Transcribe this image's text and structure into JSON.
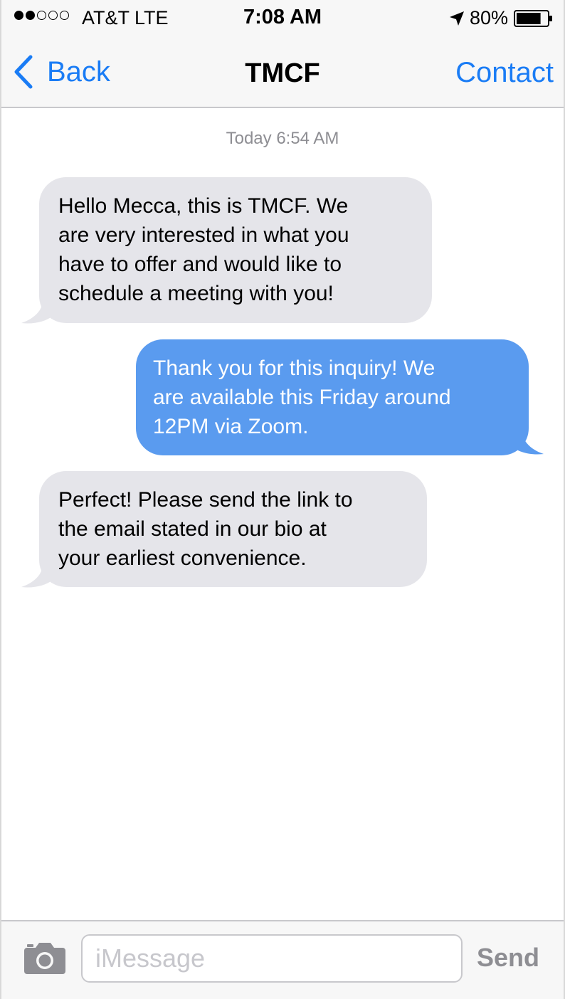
{
  "status_bar": {
    "signal_filled": 2,
    "signal_empty": 3,
    "carrier": "AT&T LTE",
    "time": "7:08 AM",
    "battery_percent": "80%",
    "battery_level": 0.8,
    "icons": [
      "signal-dots-icon",
      "location-arrow-icon",
      "battery-icon"
    ]
  },
  "nav": {
    "back_label": "Back",
    "title": "TMCF",
    "contact_label": "Contact",
    "accent_color": "#1a7cf5"
  },
  "conversation": {
    "timestamp": "Today 6:54 AM",
    "messages": [
      {
        "direction": "incoming",
        "text": "Hello Mecca, this is TMCF. We\nare very interested in what you\nhave to offer and would like to\nschedule a meeting with you!"
      },
      {
        "direction": "outgoing",
        "text": "Thank you for this inquiry! We\nare available this Friday around\n12PM via Zoom."
      },
      {
        "direction": "incoming",
        "text": "Perfect! Please send the link to\nthe email stated in our bio at\nyour earliest convenience."
      }
    ],
    "incoming_color": "#e5e5ea",
    "outgoing_color": "#5a9bef"
  },
  "composer": {
    "camera_icon": "camera-icon",
    "placeholder": "iMessage",
    "value": "",
    "send_label": "Send"
  }
}
